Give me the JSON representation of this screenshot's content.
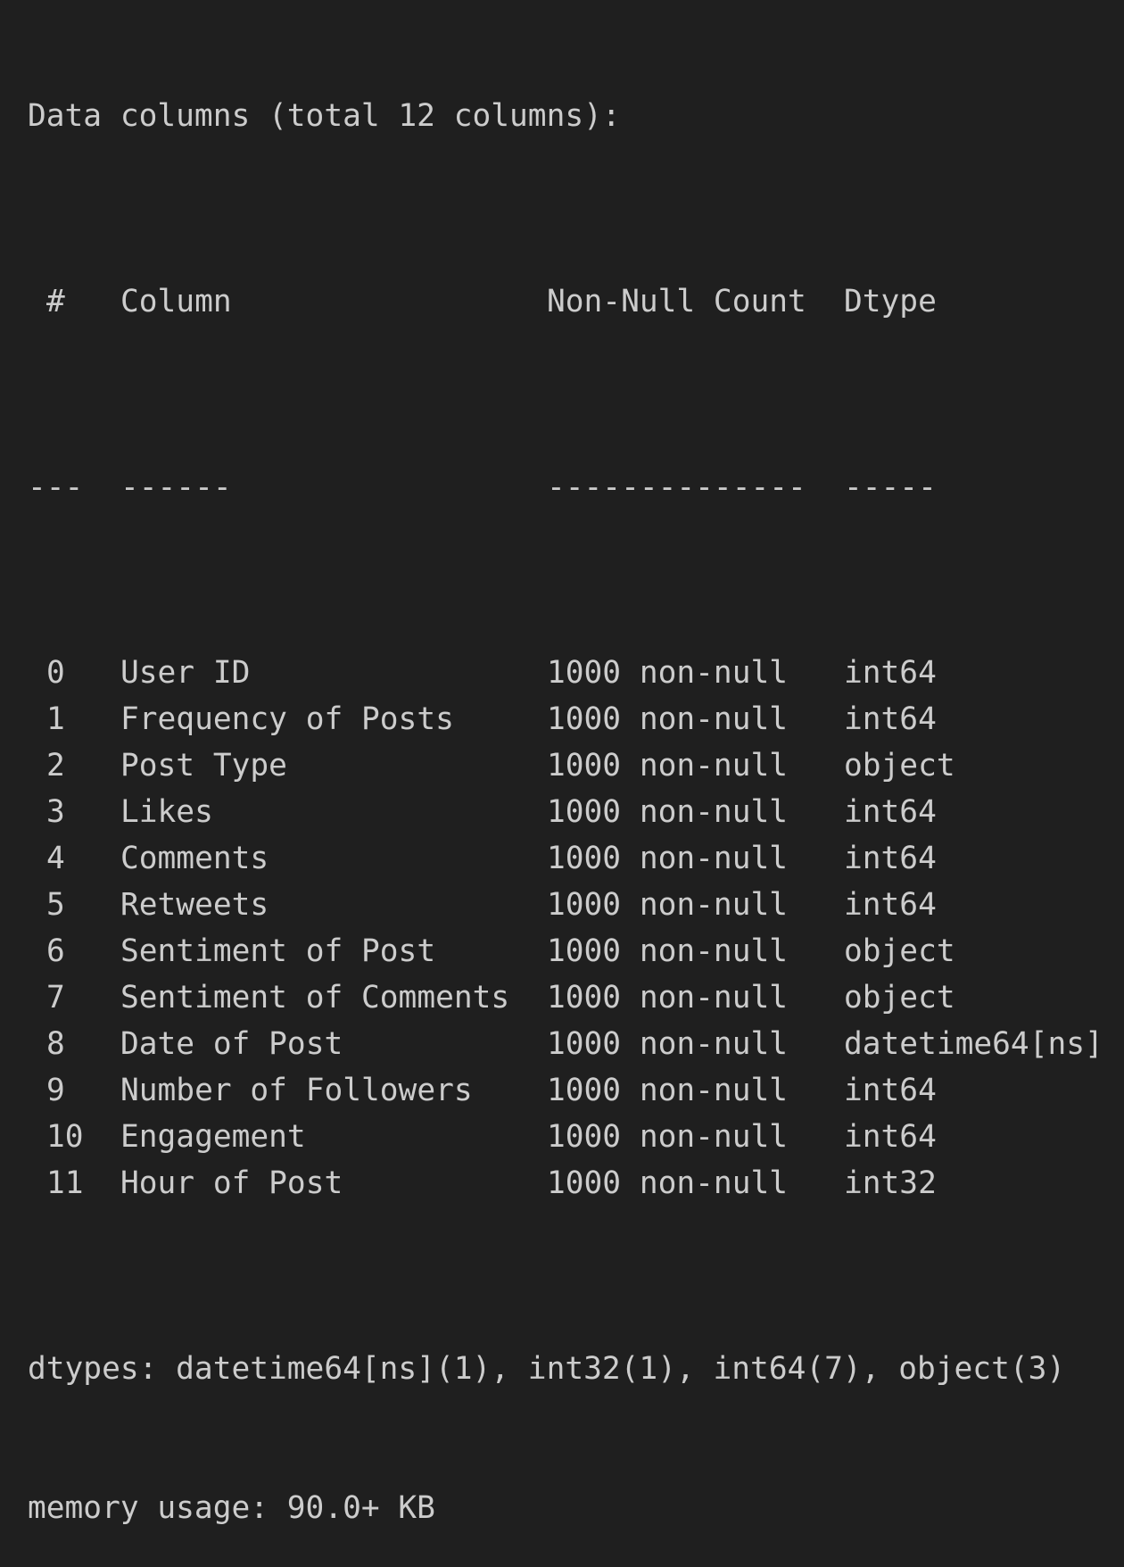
{
  "header_line": "Data columns (total 12 columns):",
  "table": {
    "headers": {
      "index": "#",
      "column": "Column",
      "count": "Non-Null Count",
      "dtype": "Dtype"
    },
    "dashes": {
      "index": "---",
      "column": "------",
      "count": "--------------",
      "dtype": "-----"
    },
    "rows": [
      {
        "index": "0",
        "column": "User ID",
        "count": "1000 non-null",
        "dtype": "int64"
      },
      {
        "index": "1",
        "column": "Frequency of Posts",
        "count": "1000 non-null",
        "dtype": "int64"
      },
      {
        "index": "2",
        "column": "Post Type",
        "count": "1000 non-null",
        "dtype": "object"
      },
      {
        "index": "3",
        "column": "Likes",
        "count": "1000 non-null",
        "dtype": "int64"
      },
      {
        "index": "4",
        "column": "Comments",
        "count": "1000 non-null",
        "dtype": "int64"
      },
      {
        "index": "5",
        "column": "Retweets",
        "count": "1000 non-null",
        "dtype": "int64"
      },
      {
        "index": "6",
        "column": "Sentiment of Post",
        "count": "1000 non-null",
        "dtype": "object"
      },
      {
        "index": "7",
        "column": "Sentiment of Comments",
        "count": "1000 non-null",
        "dtype": "object"
      },
      {
        "index": "8",
        "column": "Date of Post",
        "count": "1000 non-null",
        "dtype": "datetime64[ns]"
      },
      {
        "index": "9",
        "column": "Number of Followers",
        "count": "1000 non-null",
        "dtype": "int64"
      },
      {
        "index": "10",
        "column": "Engagement",
        "count": "1000 non-null",
        "dtype": "int64"
      },
      {
        "index": "11",
        "column": "Hour of Post",
        "count": "1000 non-null",
        "dtype": "int32"
      }
    ]
  },
  "dtypes_line": "dtypes: datetime64[ns](1), int32(1), int64(7), object(3)",
  "memory_line": "memory usage: 90.0+ KB",
  "colors": {
    "background": "#1f1f1f",
    "text": "#cccccc"
  }
}
